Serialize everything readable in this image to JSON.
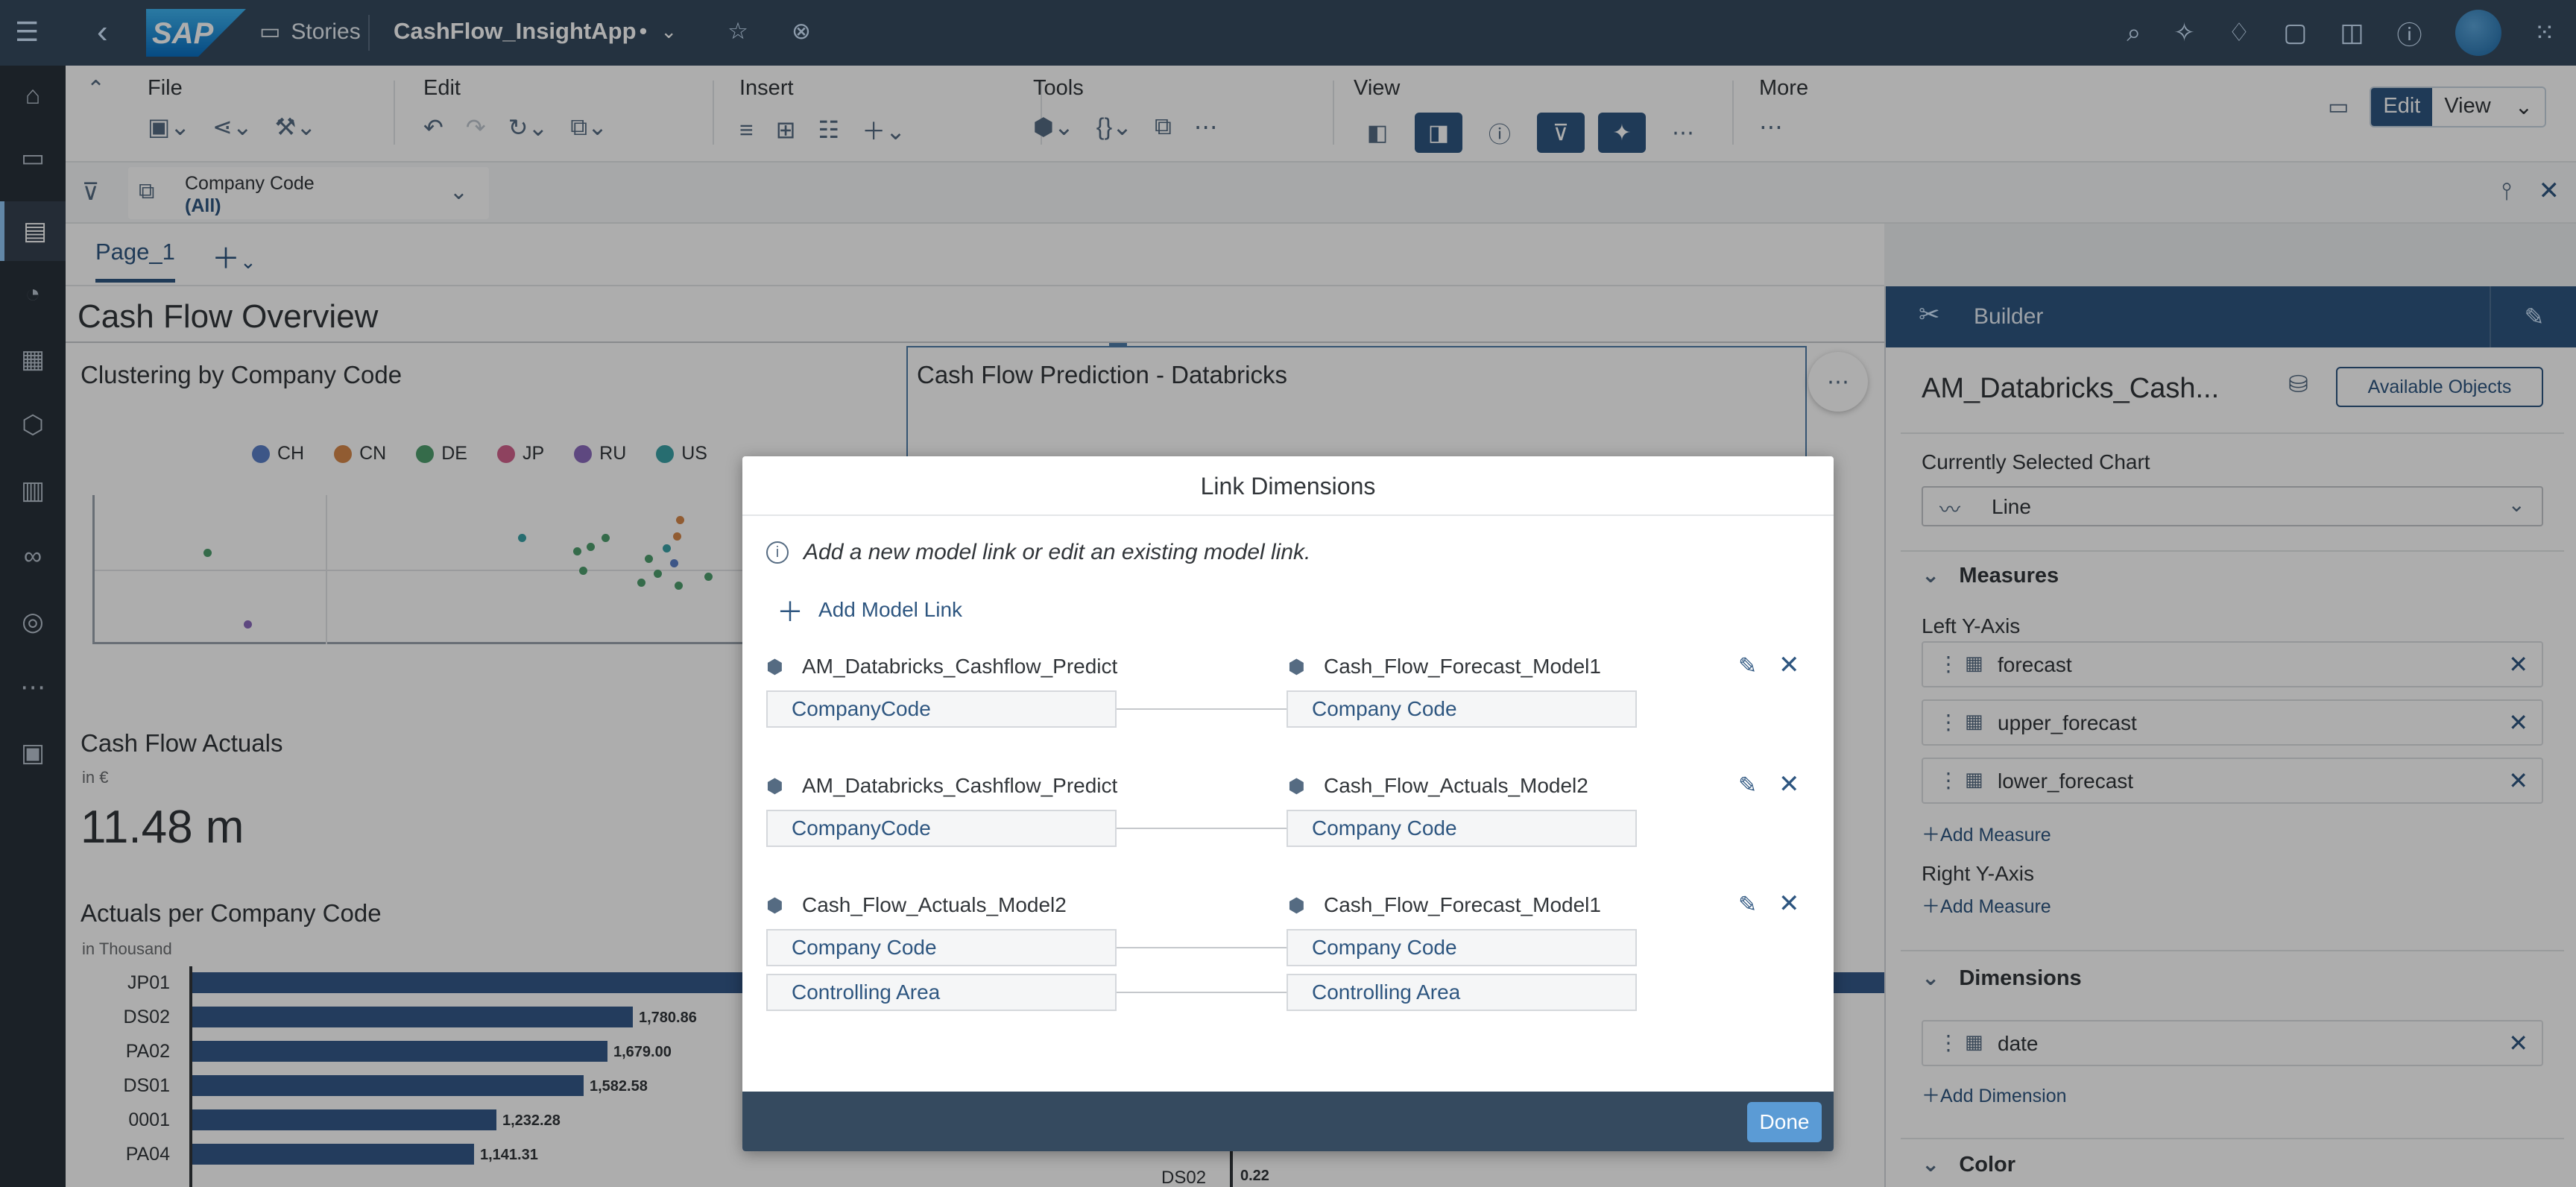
{
  "shell": {
    "stories_label": "Stories",
    "app_title": "CashFlow_InsightApp",
    "dirty_marker": "•"
  },
  "toolbar": {
    "file": "File",
    "edit": "Edit",
    "insert": "Insert",
    "tools": "Tools",
    "view": "View",
    "more": "More",
    "edit_mode": "Edit",
    "view_mode": "View"
  },
  "filter": {
    "label": "Company Code",
    "value": "(All)"
  },
  "pages": {
    "tab1": "Page_1"
  },
  "canvas": {
    "title": "Cash Flow Overview",
    "clustering_title": "Clustering by Company Code",
    "legend": [
      {
        "label": "CH",
        "color": "#5b7fc7"
      },
      {
        "label": "CN",
        "color": "#d6884a"
      },
      {
        "label": "DE",
        "color": "#4e9e6e"
      },
      {
        "label": "JP",
        "color": "#d1628d"
      },
      {
        "label": "RU",
        "color": "#8b6bbd"
      },
      {
        "label": "US",
        "color": "#3aa1a6"
      }
    ],
    "prediction_title": "Cash Flow Prediction - Databricks",
    "actuals_title": "Cash Flow Actuals",
    "actuals_unit": "in €",
    "actuals_value": "11.48 m",
    "per_cc_title": "Actuals per Company Code",
    "per_cc_unit": "in Thousand",
    "bars": [
      {
        "label": "JP01",
        "value": ""
      },
      {
        "label": "DS02",
        "value": "1,780.86"
      },
      {
        "label": "PA02",
        "value": "1,679.00"
      },
      {
        "label": "DS01",
        "value": "1,582.58"
      },
      {
        "label": "0001",
        "value": "1,232.28"
      },
      {
        "label": "PA04",
        "value": "1,141.31"
      }
    ],
    "bottom_label": "DS02",
    "bottom_value": "0.22"
  },
  "builder": {
    "title": "Builder",
    "model": "AM_Databricks_Cash...",
    "available_objects": "Available Objects",
    "current_chart_label": "Currently Selected Chart",
    "chart_type": "Line",
    "measures_label": "Measures",
    "left_y_label": "Left Y-Axis",
    "measures": [
      "forecast",
      "upper_forecast",
      "lower_forecast"
    ],
    "add_measure": "Add Measure",
    "right_y_label": "Right Y-Axis",
    "dimensions_label": "Dimensions",
    "dimension": "date",
    "add_dimension": "Add Dimension",
    "color_label": "Color"
  },
  "modal": {
    "title": "Link Dimensions",
    "info": "Add a new model link or edit an existing model link.",
    "add_link": "Add Model Link",
    "links": [
      {
        "left_model": "AM_Databricks_Cashflow_Predict",
        "right_model": "Cash_Flow_Forecast_Model1",
        "pairs": [
          [
            "CompanyCode",
            "Company Code"
          ]
        ]
      },
      {
        "left_model": "AM_Databricks_Cashflow_Predict",
        "right_model": "Cash_Flow_Actuals_Model2",
        "pairs": [
          [
            "CompanyCode",
            "Company Code"
          ]
        ]
      },
      {
        "left_model": "Cash_Flow_Actuals_Model2",
        "right_model": "Cash_Flow_Forecast_Model1",
        "pairs": [
          [
            "Company Code",
            "Company Code"
          ],
          [
            "Controlling Area",
            "Controlling Area"
          ]
        ]
      }
    ],
    "done": "Done"
  }
}
